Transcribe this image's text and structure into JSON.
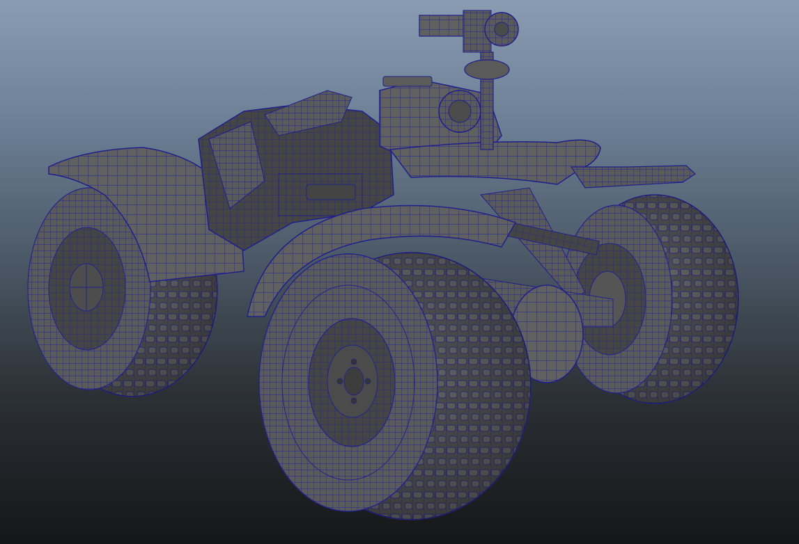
{
  "viewport": {
    "background_top": "#8a9cb2",
    "background_bottom": "#151618",
    "shading_mode": "wireframe-on-shaded"
  },
  "model": {
    "subject": "quad-bike",
    "surface_color": "#5c5c5c",
    "surface_dark": "#3e3e3e",
    "wire_color": "#1f1f9a"
  }
}
